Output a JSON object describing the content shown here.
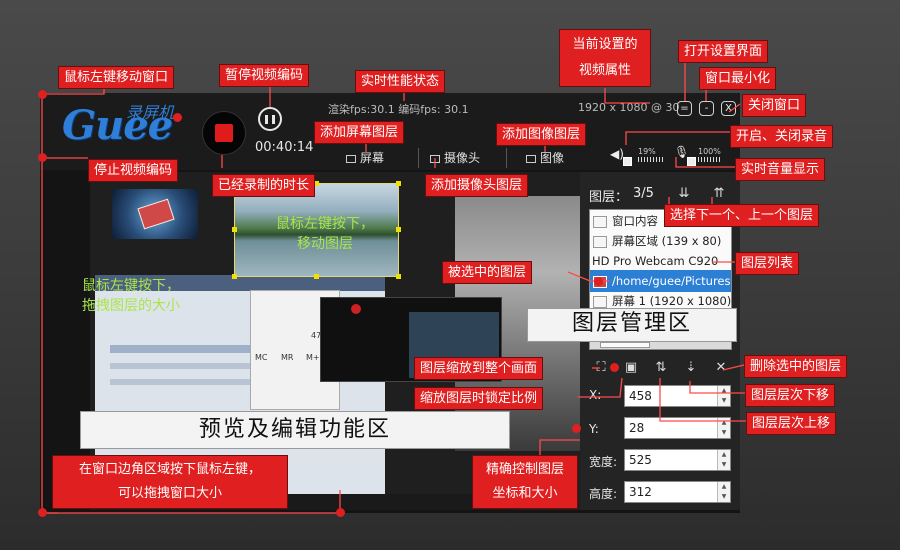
{
  "app": {
    "logo_text": "Guee",
    "logo_cn": "录屏机",
    "elapsed": "00:40:14",
    "perf": "渲染fps:30.1  编码fps:  30.1",
    "video_props": "1920 x 1080 @ 30",
    "window_buttons": [
      "=",
      "-",
      "X"
    ],
    "toolbar": [
      "屏幕",
      "摄像头",
      "图像"
    ],
    "audio": {
      "speaker_level": "19%",
      "mic_level": "100%"
    }
  },
  "preview": {
    "overlay_move": "鼠标左键按下，\n移动图层",
    "overlay_resize": "鼠标左键按下，\n拖拽图层的大小"
  },
  "panel": {
    "layers_label": "图层：",
    "layers_count": "3/5",
    "layers": [
      {
        "label": "窗口内容",
        "selected": false
      },
      {
        "label": "屏幕区域 (139 x 80)",
        "selected": false
      },
      {
        "label": "HD Pro Webcam C920",
        "selected": false
      },
      {
        "label": "/home/guee/Pictures",
        "selected": true
      },
      {
        "label": "屏幕 1 (1920 x 1080)",
        "selected": false
      }
    ],
    "fields": [
      {
        "label": "X:",
        "value": "458"
      },
      {
        "label": "Y:",
        "value": "28"
      },
      {
        "label": "宽度:",
        "value": "525"
      },
      {
        "label": "高度:",
        "value": "312"
      }
    ]
  },
  "annotations": {
    "move_window": "鼠标左键移动窗口",
    "pause_encoding": "暂停视频编码",
    "perf_status": "实时性能状态",
    "current_props": "当前设置的\n视频属性",
    "open_settings": "打开设置界面",
    "minimize": "窗口最小化",
    "close": "关闭窗口",
    "add_screen_layer": "添加屏幕图层",
    "add_image_layer": "添加图像图层",
    "toggle_audio": "开启、关闭录音",
    "stop_encoding": "停止视频编码",
    "recorded_time": "已经录制的时长",
    "add_camera_layer": "添加摄像头图层",
    "realtime_volume": "实时音量显示",
    "select_next_prev": "选择下一个、上一个图层",
    "selected_layer": "被选中的图层",
    "layer_list": "图层列表",
    "layer_manager": "图层管理区",
    "fit_layer": "图层缩放到整个画面",
    "delete_layer": "删除选中的图层",
    "lock_ratio": "缩放图层时锁定比例",
    "move_down": "图层层次下移",
    "move_up": "图层层次上移",
    "preview_edit": "预览及编辑功能区",
    "precise_control": "精确控制图层\n坐标和大小",
    "resize_window": "在窗口边角区域按下鼠标左键，\n可以拖拽窗口大小"
  }
}
